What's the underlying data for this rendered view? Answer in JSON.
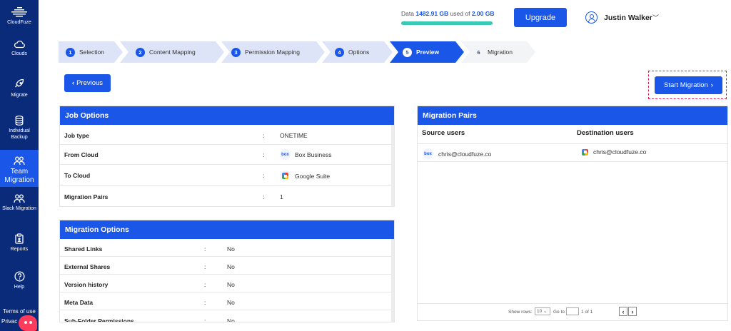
{
  "brand": {
    "name": "CloudFuze"
  },
  "sidebar": {
    "items": [
      {
        "label": "Clouds",
        "icon": "cloud-icon"
      },
      {
        "label": "Migrate",
        "icon": "rocket-icon"
      },
      {
        "label": "Individual Backup",
        "icon": "database-icon"
      },
      {
        "label": "Team Migration",
        "icon": "team-icon",
        "active": true
      },
      {
        "label": "Slack Migration",
        "icon": "users-icon"
      },
      {
        "label": "Reports",
        "icon": "clipboard-icon"
      },
      {
        "label": "Help",
        "icon": "help-icon"
      }
    ],
    "terms": "Terms of use",
    "privacy": "Privac"
  },
  "header": {
    "data_prefix": "Data",
    "data_used": "1482.91 GB",
    "data_middle": "used of",
    "data_total": "2.00 GB",
    "usage_percent": 100,
    "upgrade_label": "Upgrade",
    "user_name": "Justin Walker"
  },
  "stepper": {
    "steps": [
      {
        "num": "1",
        "label": "Selection",
        "state": "done"
      },
      {
        "num": "2",
        "label": "Content Mapping",
        "state": "done"
      },
      {
        "num": "3",
        "label": "Permission Mapping",
        "state": "done"
      },
      {
        "num": "4",
        "label": "Options",
        "state": "done"
      },
      {
        "num": "5",
        "label": "Preview",
        "state": "active"
      },
      {
        "num": "6",
        "label": "Migration",
        "state": "upcoming"
      }
    ]
  },
  "actions": {
    "previous_label": "Previous",
    "start_label": "Start Migration"
  },
  "job_options": {
    "title": "Job Options",
    "rows": [
      {
        "key": "Job type",
        "value": "ONETIME"
      },
      {
        "key": "From Cloud",
        "value": "Box Business",
        "logo": "box"
      },
      {
        "key": "To Cloud",
        "value": "Google Suite",
        "logo": "gsuite"
      },
      {
        "key": "Migration Pairs",
        "value": "1"
      }
    ]
  },
  "migration_options": {
    "title": "Migration Options",
    "rows": [
      {
        "key": "Shared Links",
        "value": "No"
      },
      {
        "key": "External Shares",
        "value": "No"
      },
      {
        "key": "Version history",
        "value": "No"
      },
      {
        "key": "Meta Data",
        "value": "No"
      },
      {
        "key": "Sub-Folder Permissions",
        "value": "No"
      }
    ]
  },
  "migration_pairs": {
    "title": "Migration Pairs",
    "source_header": "Source users",
    "destination_header": "Destination users",
    "rows": [
      {
        "source": "chris@cloudfuze.co",
        "destination": "chris@cloudfuze.co"
      }
    ],
    "pager": {
      "show_rows_label": "Show rows:",
      "rows_value": "10",
      "goto_label": "Go to:",
      "page_info": "1 of 1"
    }
  },
  "colors": {
    "primary": "#1a56e8",
    "sidebar": "#0a2a7a",
    "usage_bar": "#3cc9b4",
    "highlight_border": "#d81b4a"
  },
  "separator": ":"
}
